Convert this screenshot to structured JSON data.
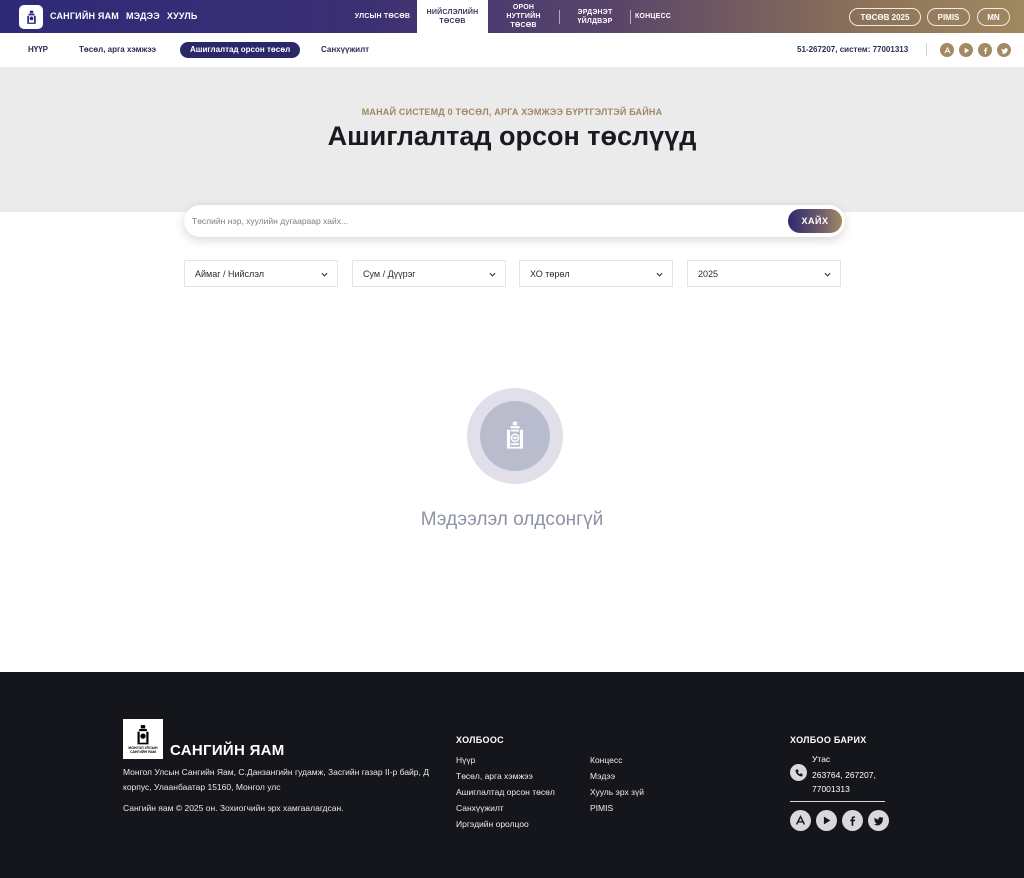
{
  "top": {
    "brand": [
      "САНГИЙН ЯАМ",
      "МЭДЭЭ",
      "ХУУЛЬ"
    ],
    "nav": [
      {
        "label": "УЛСЫН ТӨСӨВ"
      },
      {
        "label": "НИЙСЛЭЛИЙН ТӨСӨВ"
      },
      {
        "label": "ОРОН НУТГИЙН ТӨСӨВ"
      },
      {
        "label": "ЭРДЭНЭТ ҮЙЛДВЭР"
      },
      {
        "label": "КОНЦЕСС"
      }
    ],
    "budget_button": "ТӨСӨВ 2025",
    "pimis_button": "PIMIS",
    "lang_button": "MN"
  },
  "subnav": {
    "links": [
      "НҮҮР",
      "Төсөл, арга хэмжээ",
      "Ашиглалтад орсон төсөл",
      "Санхүүжилт"
    ],
    "phone": "51-267207, систем: 77001313"
  },
  "hero": {
    "kicker": "МАНАЙ СИСТЕМД 0 ТӨСӨЛ, АРГА ХЭМЖЭЭ БҮРТГЭЛТЭЙ БАЙНА",
    "title": "Ашиглалтад орсон төслүүд"
  },
  "search": {
    "placeholder": "Төслийн нэр, хуулийн дугаараар хайх...",
    "button": "ХАЙХ"
  },
  "filters": [
    "Аймаг / Нийслэл",
    "Сум / Дүүрэг",
    "ХО төрөл",
    "2025"
  ],
  "empty": {
    "message": "Мэдээлэл олдсонгүй"
  },
  "footer": {
    "logo_text": "МОНГОЛ УЛСЫН САНГИЙН ЯАМ",
    "brand": "САНГИЙН ЯАМ",
    "address": "Монгол Улсын Сангийн Яам, С.Данзангийн гудамж, Засгийн газар II-р байр, Д корпус, Улаанбаатар 15160, Монгол улс",
    "copyright": "Сангийн яам © 2025 он. Зохиогчийн эрх хамгаалагдсан.",
    "links_heading": "ХОЛБООС",
    "links_col1": [
      "Нүүр",
      "Төсөл, арга хэмжээ",
      "Ашиглалтад орсон төсөл",
      "Санхүүжилт",
      "Иргэдийн оролцоо"
    ],
    "links_col2": [
      "Концесс",
      "Мэдээ",
      "Хууль эрх зүй",
      "PIMIS"
    ],
    "contact_heading": "ХОЛБОО БАРИХ",
    "phone_label": "Утас",
    "phone_value": "263764, 267207, 77001313"
  },
  "colors": {
    "brand_navy": "#2b2869",
    "brand_gold": "#a48a62",
    "footer_bg": "#15161b",
    "hero_bg": "#ebebeb"
  }
}
